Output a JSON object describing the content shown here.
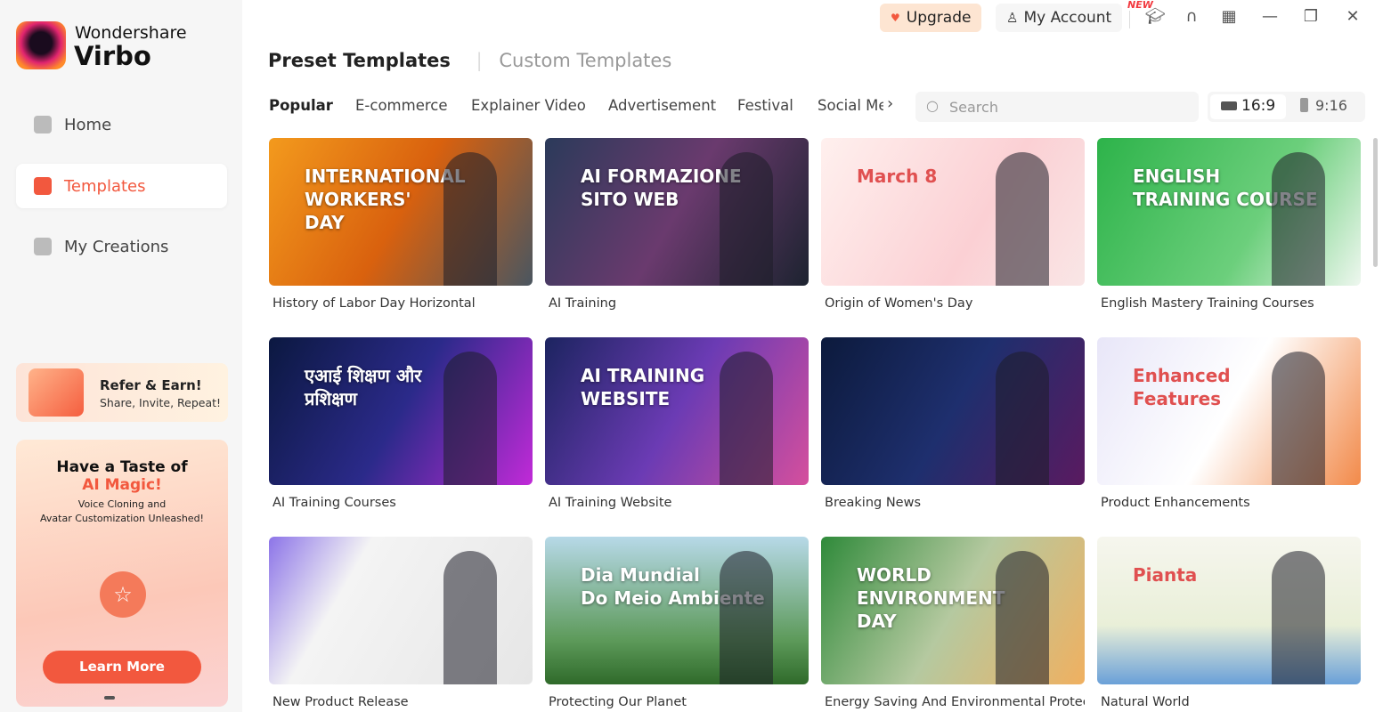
{
  "app": {
    "brand_line1": "Wondershare",
    "brand_line2": "Virbo"
  },
  "sidebar": {
    "items": [
      {
        "label": "Home",
        "icon": "home-icon"
      },
      {
        "label": "Templates",
        "icon": "templates-icon",
        "active": true
      },
      {
        "label": "My Creations",
        "icon": "creations-icon"
      }
    ],
    "refer": {
      "title": "Refer & Earn!",
      "subtitle": "Share, Invite, Repeat!"
    },
    "promo": {
      "title": "Have a Taste of",
      "highlight": "AI Magic!",
      "line1": "Voice Cloning and",
      "line2": "Avatar Customization Unleashed!",
      "button": "Learn More"
    }
  },
  "topbar": {
    "upgrade": "Upgrade",
    "account": "My Account",
    "new_badge": "NEW",
    "icons": [
      "academy-icon",
      "support-icon",
      "apps-grid-icon",
      "minimize-icon",
      "restore-icon",
      "close-icon"
    ]
  },
  "main": {
    "tabs": [
      {
        "label": "Preset Templates",
        "active": true
      },
      {
        "label": "Custom Templates"
      }
    ],
    "categories": [
      "Popular",
      "E-commerce",
      "Explainer Video",
      "Advertisement",
      "Festival",
      "Social Me"
    ],
    "search_placeholder": "Search",
    "ratios": [
      {
        "label": "16:9",
        "active": true
      },
      {
        "label": "9:16"
      }
    ],
    "accent": "#f2583e",
    "templates": [
      {
        "title": "History of Labor Day Horizontal",
        "headline": "INTERNATIONAL\nWORKERS'\nDAY",
        "bg": "linear-gradient(120deg,#f39a1d,#d9610e 50%,#4a5660)"
      },
      {
        "title": "AI Training",
        "headline": "AI FORMAZIONE\nSITO WEB",
        "bg": "linear-gradient(120deg,#2b3a5a,#6a3a6e 50%,#1d2330)"
      },
      {
        "title": "Origin of Women's Day",
        "headline": "March 8",
        "bg": "linear-gradient(120deg,#fff0ee,#fbd0d4 60%,#f9e6e6)"
      },
      {
        "title": "English Mastery Training Courses",
        "headline": "ENGLISH\nTRAINING COURSE",
        "bg": "linear-gradient(120deg,#2db34a,#6ccf7c 60%,#eef7ef)"
      },
      {
        "title": "AI Training Courses",
        "headline": "एआई शिक्षण और\nप्रशिक्षण",
        "bg": "linear-gradient(120deg,#0b1840,#2b2a8a 50%,#c12ad8)"
      },
      {
        "title": "AI Training Website",
        "headline": "AI TRAINING\nWEBSITE",
        "bg": "linear-gradient(120deg,#1c2460,#6b3bb4 50%,#d54f9d)"
      },
      {
        "title": "Breaking News",
        "headline": "",
        "bg": "linear-gradient(120deg,#0c1a3c,#1e2f6e 50%,#5a1a60)"
      },
      {
        "title": "Product Enhancements",
        "headline": "Enhanced\nFeatures",
        "bg": "linear-gradient(120deg,#e8e6f8,#ffffff 50%,#f28a4a)"
      },
      {
        "title": "New Product Release",
        "headline": "",
        "bg": "linear-gradient(120deg,#8c74e8,#f4f4f4 30%,#e6e6e6)"
      },
      {
        "title": "Protecting Our Planet",
        "headline": "Dia Mundial\nDo Meio Ambiente",
        "bg": "linear-gradient(180deg,#b7d9e8,#5d9a5a 70%,#2f6a2a)"
      },
      {
        "title": "Energy Saving And Environmental Protect...",
        "headline": "WORLD\nENVIRONMENT\nDAY",
        "bg": "linear-gradient(120deg,#2f8a3a,#b5c9a0 50%,#f0b060)"
      },
      {
        "title": "Natural World",
        "headline": "Pianta",
        "bg": "linear-gradient(180deg,#f6f6ee,#e9efd8 60%,#6aa0d8)"
      }
    ]
  }
}
